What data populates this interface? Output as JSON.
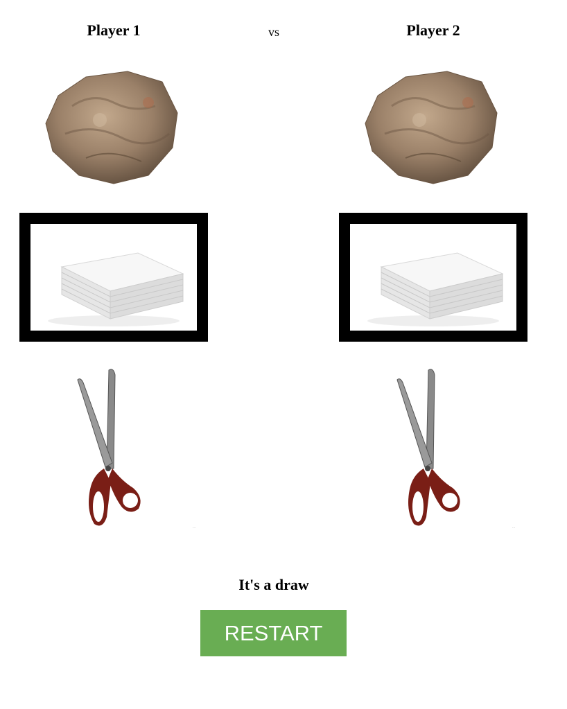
{
  "players": {
    "p1": {
      "label": "Player 1",
      "selected": "paper"
    },
    "p2": {
      "label": "Player 2",
      "selected": "paper"
    }
  },
  "vs_label": "vs",
  "choices": [
    {
      "id": "rock",
      "icon": "rock-icon"
    },
    {
      "id": "paper",
      "icon": "paper-stack-icon"
    },
    {
      "id": "scissors",
      "icon": "scissors-icon"
    }
  ],
  "result_text": "It's a draw",
  "restart_label": "RESTART",
  "colors": {
    "restart_button": "#69ad53",
    "selection_border": "#000000",
    "scissors_handle": "#7a1e16"
  }
}
